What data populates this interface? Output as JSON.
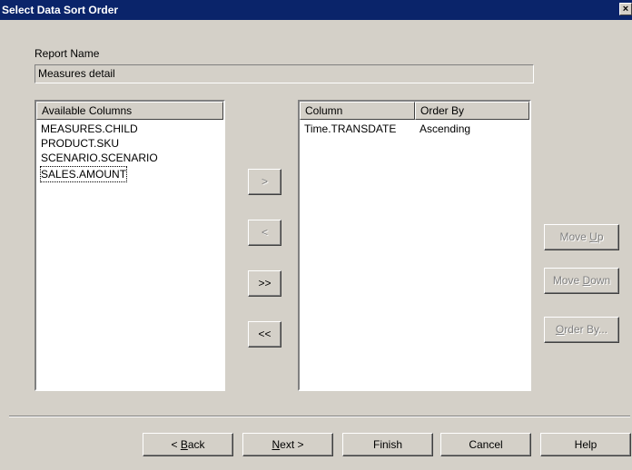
{
  "window": {
    "title": "Select Data Sort Order",
    "close_glyph": "×"
  },
  "report": {
    "label": "Report Name",
    "value": "Measures detail"
  },
  "available": {
    "header": "Available Columns",
    "items": [
      "MEASURES.CHILD",
      "PRODUCT.SKU",
      "SCENARIO.SCENARIO",
      "SALES.AMOUNT"
    ]
  },
  "sort": {
    "col_header": "Column",
    "order_header": "Order By",
    "rows": [
      {
        "column": "Time.TRANSDATE",
        "order": "Ascending"
      }
    ]
  },
  "transfer": {
    "add": ">",
    "remove": "<",
    "add_all": ">>",
    "remove_all": "<<"
  },
  "side": {
    "move_up_pre": "Move ",
    "move_up_key": "U",
    "move_up_post": "p",
    "move_down_pre": "Move ",
    "move_down_key": "D",
    "move_down_post": "own",
    "order_by_key": "O",
    "order_by_post": "rder By..."
  },
  "nav": {
    "back_pre": "< ",
    "back_key": "B",
    "back_post": "ack",
    "next_key": "N",
    "next_post": "ext >",
    "finish": "Finish",
    "cancel": "Cancel",
    "help": "Help"
  }
}
